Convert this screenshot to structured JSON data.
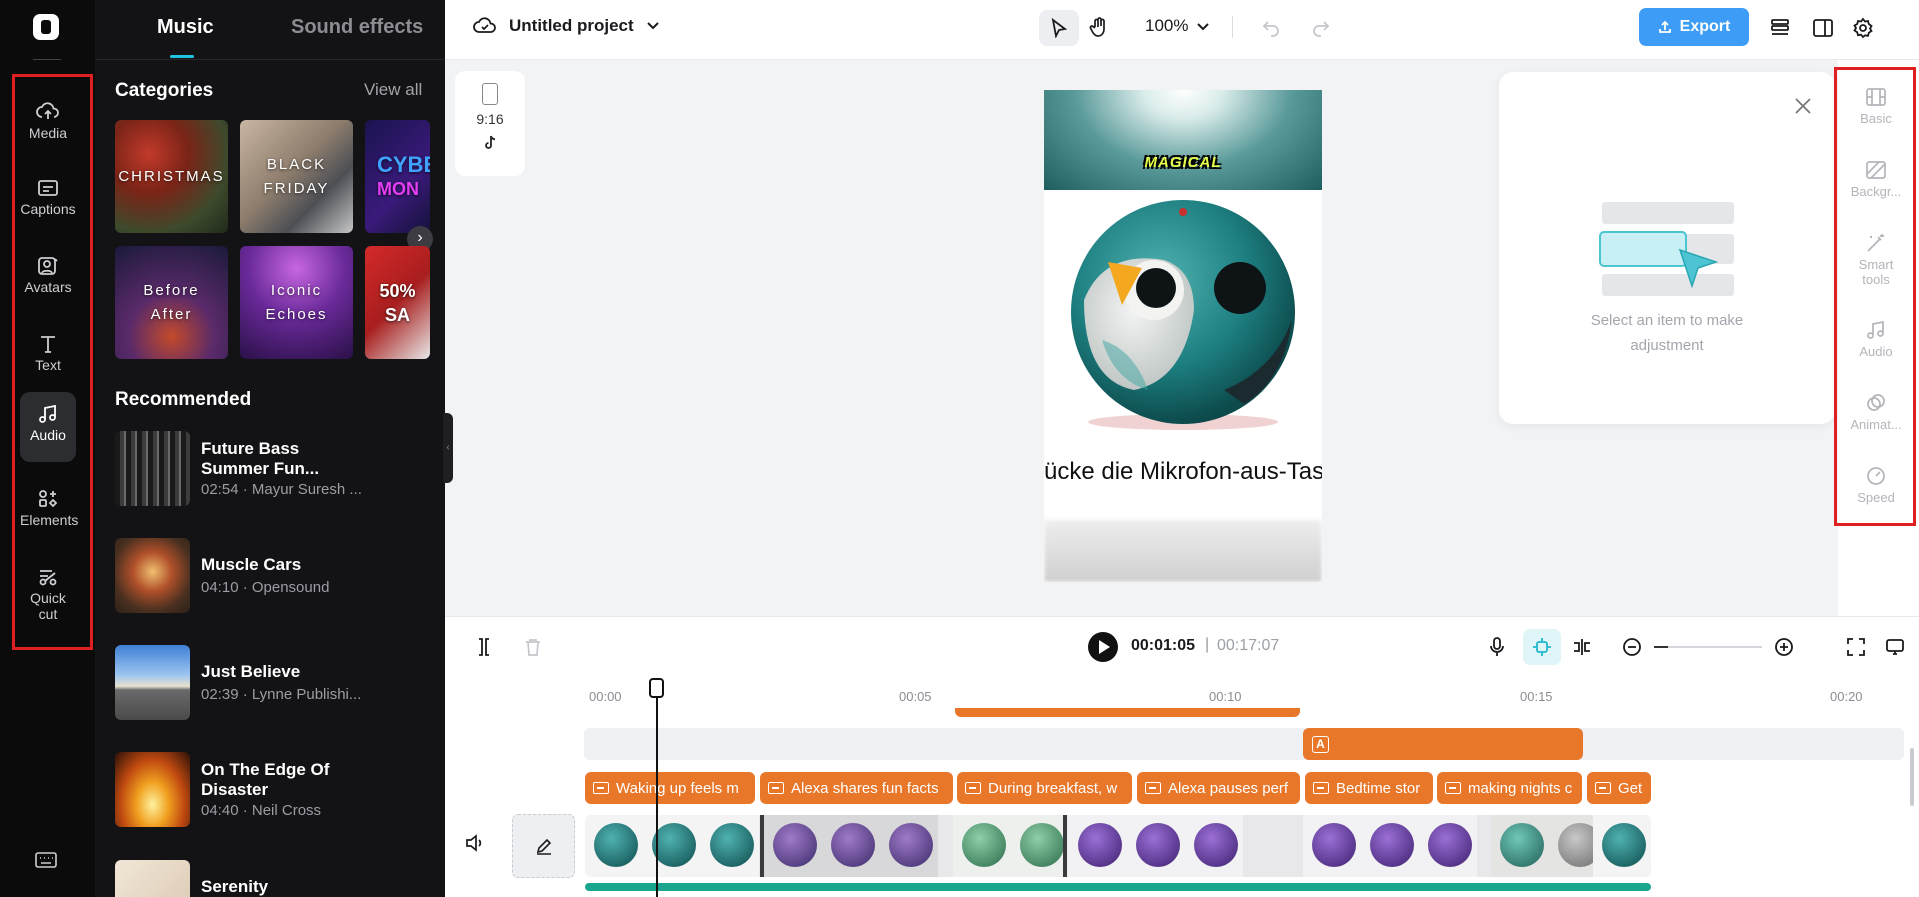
{
  "rail": {
    "items": [
      {
        "label": "Media",
        "icon": "cloud-upload-icon"
      },
      {
        "label": "Captions",
        "icon": "captions-icon"
      },
      {
        "label": "Avatars",
        "icon": "avatar-icon"
      },
      {
        "label": "Text",
        "icon": "text-icon"
      },
      {
        "label": "Audio",
        "icon": "music-note-icon"
      },
      {
        "label": "Elements",
        "icon": "elements-icon"
      },
      {
        "label": "Quick",
        "label2": "cut",
        "icon": "scissors-icon"
      }
    ],
    "active": "Audio"
  },
  "panel": {
    "tabs": [
      "Music",
      "Sound effects"
    ],
    "categories_title": "Categories",
    "view_all": "View all",
    "categories": [
      {
        "label": "CHRISTMAS",
        "label2": ""
      },
      {
        "label": "BLACK",
        "label2": "FRIDAY"
      },
      {
        "label": "CYBE",
        "label2": "MON"
      },
      {
        "label": "Before",
        "label2": "After"
      },
      {
        "label": "Iconic",
        "label2": "Echoes"
      },
      {
        "label": "50%",
        "label2": "SA"
      }
    ],
    "recommended_title": "Recommended",
    "tracks": [
      {
        "title": "Future Bass Summer Fun...",
        "meta": "02:54 · Mayur Suresh ..."
      },
      {
        "title": "Muscle Cars",
        "meta": "04:10 · Opensound"
      },
      {
        "title": "Just Believe",
        "meta": "02:39 · Lynne Publishi..."
      },
      {
        "title": "On The Edge Of Disaster",
        "meta": "04:40 · Neil Cross"
      },
      {
        "title": "Serenity",
        "meta": ""
      }
    ]
  },
  "topbar": {
    "project_name": "Untitled project",
    "zoom": "100%",
    "export_label": "Export"
  },
  "canvas": {
    "ratio_label": "9:16",
    "preview_overlay_text": "MAGICAL",
    "preview_caption": "rücke die Mikrofon-aus-Tast"
  },
  "properties": {
    "hint": "Select an item to make adjustment"
  },
  "right_rail": {
    "items": [
      {
        "label": "Basic",
        "icon": "basic-icon"
      },
      {
        "label": "Backgr...",
        "icon": "background-icon"
      },
      {
        "label": "Smart",
        "label2": "tools",
        "icon": "magic-wand-icon"
      },
      {
        "label": "Audio",
        "icon": "music-note-icon"
      },
      {
        "label": "Animat...",
        "icon": "animation-icon"
      },
      {
        "label": "Speed",
        "icon": "speed-icon"
      }
    ]
  },
  "timeline": {
    "current_time": "00:01:05",
    "separator": "|",
    "total_time": "00:17:07",
    "ruler": [
      "00:00",
      "00:05",
      "00:10",
      "00:15",
      "00:20"
    ],
    "text_clip_label": "A",
    "captions": [
      "Waking up feels m",
      "Alexa shares fun facts",
      "During breakfast, w",
      "Alexa pauses perf",
      "Bedtime stor",
      "making nights c",
      "Get"
    ]
  },
  "colors": {
    "accent": "#1fc2e0",
    "export": "#3d9df6",
    "clip_orange": "#e9772a",
    "highlight_red": "#e02020"
  }
}
